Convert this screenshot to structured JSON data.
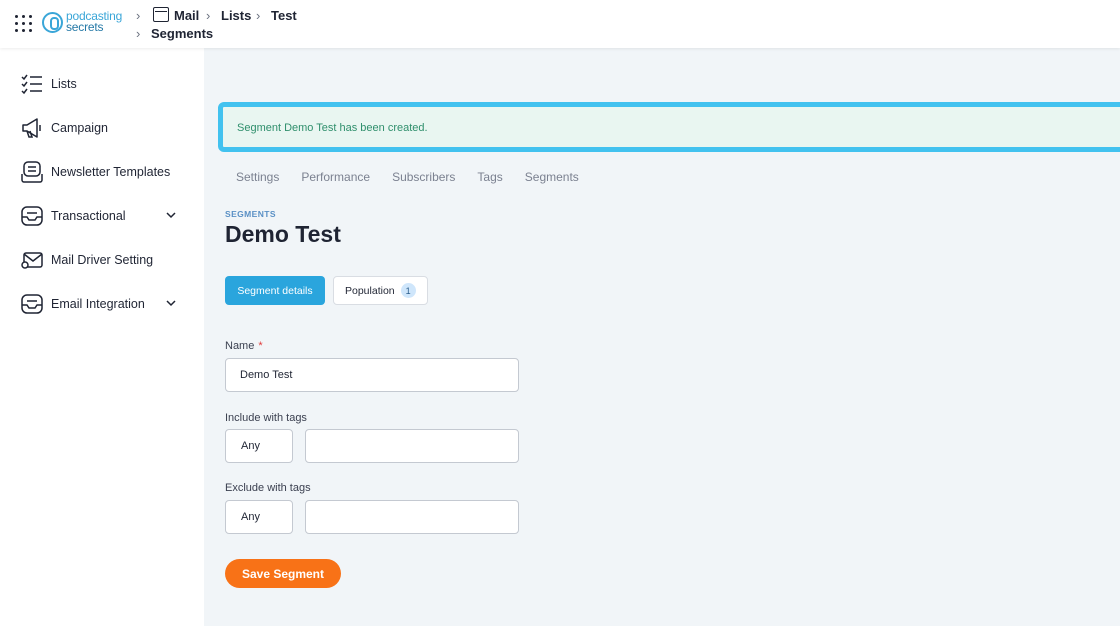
{
  "header": {
    "logo_line1": "podcasting",
    "logo_line2": "secrets",
    "breadcrumb": [
      "Mail",
      "Lists",
      "Test",
      "Segments"
    ]
  },
  "sidebar": {
    "items": [
      {
        "label": "Lists",
        "icon": "checklist-icon"
      },
      {
        "label": "Campaign",
        "icon": "megaphone-icon"
      },
      {
        "label": "Newsletter Templates",
        "icon": "newsletter-icon"
      },
      {
        "label": "Transactional",
        "icon": "inbox-icon",
        "expandable": true
      },
      {
        "label": "Mail Driver Setting",
        "icon": "mail-settings-icon"
      },
      {
        "label": "Email Integration",
        "icon": "inbox-icon",
        "expandable": true
      }
    ]
  },
  "alert": {
    "message": "Segment Demo Test has been created.",
    "color": "#2f8f6c"
  },
  "tabs": [
    "Settings",
    "Performance",
    "Subscribers",
    "Tags",
    "Segments"
  ],
  "page": {
    "eyebrow": "SEGMENTS",
    "title": "Demo Test"
  },
  "subtabs": {
    "details_label": "Segment details",
    "population_label": "Population",
    "population_count": "1"
  },
  "form": {
    "name_label": "Name",
    "required_mark": "*",
    "name_value": "Demo Test",
    "include_label": "Include with tags",
    "include_mode": "Any",
    "include_value": "",
    "exclude_label": "Exclude with tags",
    "exclude_mode": "Any",
    "exclude_value": "",
    "save_label": "Save Segment"
  },
  "colors": {
    "accent": "#2aa5dd",
    "save": "#f87217",
    "alert_border": "#42c2ef"
  }
}
